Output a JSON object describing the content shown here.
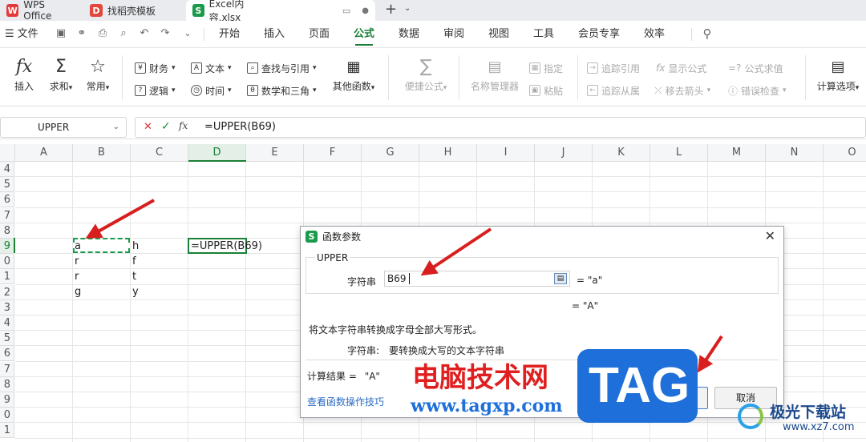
{
  "tabs": [
    {
      "label": "WPS Office",
      "icon": "wps-logo-icon"
    },
    {
      "label": "找稻壳模板",
      "icon": "docer-icon"
    },
    {
      "label": "Excel内容.xlsx",
      "icon": "spreadsheet-icon"
    }
  ],
  "menu": {
    "file": "文件",
    "items": [
      "开始",
      "插入",
      "页面",
      "公式",
      "数据",
      "审阅",
      "视图",
      "工具",
      "会员专享",
      "效率"
    ],
    "active": "公式"
  },
  "ribbon": {
    "insert": "插入",
    "sum": "求和",
    "common": "常用",
    "finance": "财务",
    "text": "文本",
    "lookup": "查找与引用",
    "logic": "逻辑",
    "time": "时间",
    "math": "数学和三角",
    "other": "其他函数",
    "quick": "便捷公式",
    "name_mgr": "名称管理器",
    "assign": "指定",
    "paste": "粘贴",
    "trace_prec": "追踪引用",
    "show_formula": "显示公式",
    "eval_formula": "公式求值",
    "trace_dep": "追踪从属",
    "remove_arrows": "移去箭头",
    "error_check": "错误检查",
    "calc_options": "计算选项"
  },
  "formula_bar": {
    "name_box": "UPPER",
    "formula": "=UPPER(B69)"
  },
  "grid": {
    "columns": [
      "A",
      "B",
      "C",
      "D",
      "E",
      "F",
      "G",
      "H",
      "I",
      "J",
      "K",
      "L",
      "M",
      "N",
      "O"
    ],
    "row_numbers": [
      "4",
      "5",
      "6",
      "7",
      "8",
      "9",
      "0",
      "1",
      "2",
      "3",
      "4",
      "5",
      "6",
      "7",
      "8",
      "9",
      "0",
      "1"
    ],
    "cells": {
      "b1": "a",
      "b2": "r",
      "b3": "r",
      "b4": "g",
      "c1": "h",
      "c2": "f",
      "c3": "t",
      "c4": "y",
      "d1": "=UPPER(B69)"
    }
  },
  "dialog": {
    "title": "函数参数",
    "func_name": "UPPER",
    "arg_label": "字符串",
    "arg_value": "B69",
    "arg_result": "= \"a\"",
    "result_preview": "= \"A\"",
    "description": "将文本字符串转换成字母全部大写形式。",
    "arg_desc_label": "字符串:",
    "arg_desc": "要转换成大写的文本字符串",
    "calc_result_label": "计算结果 =",
    "calc_result": "\"A\"",
    "help_link": "查看函数操作技巧",
    "ok": "确定",
    "cancel": "取消"
  },
  "watermark": {
    "site_cn": "电脑技术网",
    "url": "www.tagxp.com",
    "tag": "TAG",
    "corner": "极光下载站",
    "corner_url": "www.xz7.com"
  },
  "colors": {
    "accent": "#1a7f37",
    "arrow": "#d81e1e",
    "watermark_red": "#e02020",
    "tag_blue": "#1e6fd9"
  }
}
